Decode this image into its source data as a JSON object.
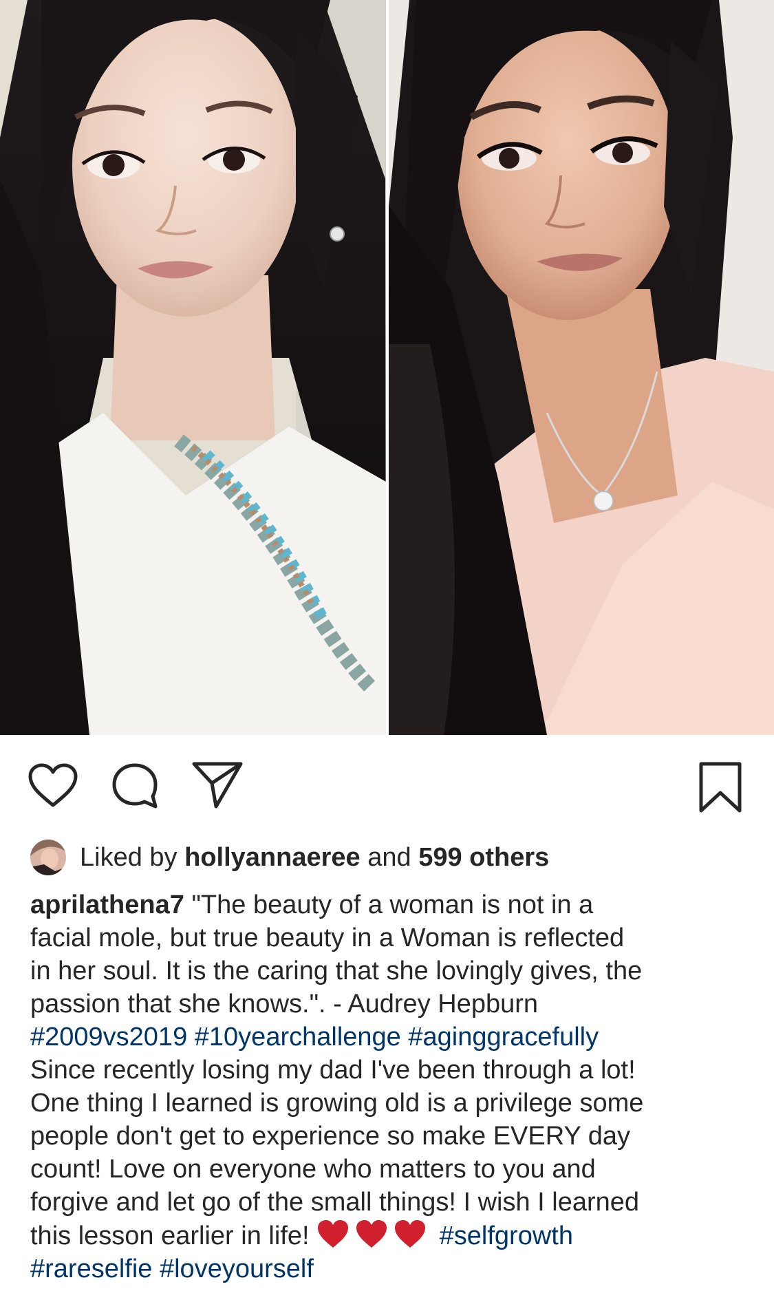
{
  "post": {
    "likes": {
      "prefix": "Liked by",
      "user": "hollyannaeree",
      "conjunction": "and",
      "count_text": "599 others"
    },
    "caption": {
      "username": "aprilathena7",
      "quote_lines": [
        "\"The beauty of a woman is not in a",
        "facial mole, but true beauty in a Woman is reflected",
        "in her soul. It is the caring that she lovingly gives, the",
        "passion that she knows.\". - Audrey Hepburn"
      ],
      "hashtags_1": [
        "#2009vs2019",
        "#10yearchallenge",
        "#aginggracefully"
      ],
      "body_lines": [
        "Since recently losing my dad I've been through a lot!",
        "One thing I learned is growing old is a privilege some",
        "people don't get to experience so make EVERY day",
        "count! Love on everyone who matters to you and",
        "forgive and let go of the small things! I wish I learned",
        "this lesson earlier in life!"
      ],
      "emoji_hearts": 3,
      "hashtag_inline": "#selfgrowth",
      "hashtags_2": [
        "#rareselfie",
        "#loveyourself"
      ]
    }
  },
  "icons": {
    "like": "heart-outline-icon",
    "comment": "comment-bubble-icon",
    "share": "paper-plane-icon",
    "save": "bookmark-icon"
  },
  "colors": {
    "text": "#262626",
    "hashtag": "#003569",
    "emoji_heart": "#d01f2d",
    "icon_stroke": "#262626"
  }
}
